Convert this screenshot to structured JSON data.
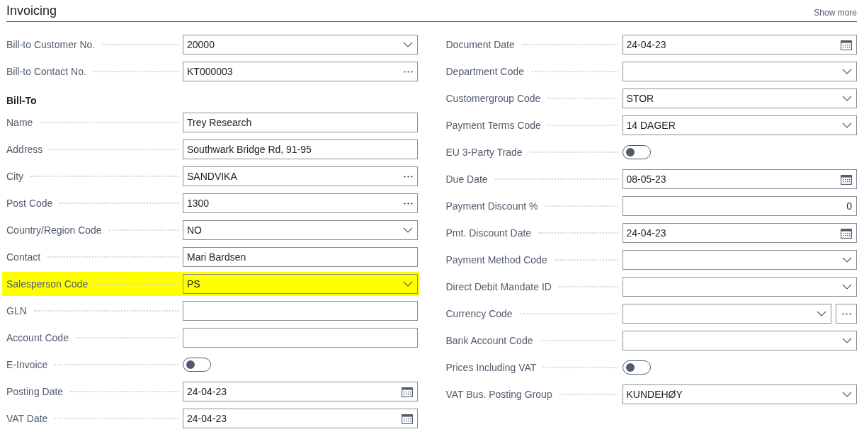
{
  "section": {
    "title": "Invoicing",
    "show_more": "Show more"
  },
  "left_fields": [
    {
      "kind": "dropdown",
      "label": "Bill-to Customer No.",
      "value": "20000",
      "highlighted": false
    },
    {
      "kind": "lookup",
      "label": "Bill-to Contact No.",
      "value": "KT000003",
      "highlighted": false
    },
    {
      "kind": "heading",
      "label": "Bill-To",
      "highlighted": false
    },
    {
      "kind": "text",
      "label": "Name",
      "value": "Trey Research",
      "highlighted": false
    },
    {
      "kind": "text",
      "label": "Address",
      "value": "Southwark Bridge Rd, 91-95",
      "highlighted": false
    },
    {
      "kind": "lookup",
      "label": "City",
      "value": "SANDVIKA",
      "highlighted": false
    },
    {
      "kind": "lookup",
      "label": "Post Code",
      "value": "1300",
      "highlighted": false
    },
    {
      "kind": "dropdown",
      "label": "Country/Region Code",
      "value": "NO",
      "highlighted": false
    },
    {
      "kind": "text",
      "label": "Contact",
      "value": "Mari Bardsen",
      "highlighted": false
    },
    {
      "kind": "dropdown",
      "label": "Salesperson Code",
      "value": "PS",
      "highlighted": true
    },
    {
      "kind": "text",
      "label": "GLN",
      "highlighted": false
    },
    {
      "kind": "text",
      "label": "Account Code",
      "highlighted": false
    },
    {
      "kind": "toggle",
      "label": "E-Invoice",
      "on": false,
      "highlighted": false
    },
    {
      "kind": "date",
      "label": "Posting Date",
      "value": "24-04-23",
      "highlighted": false
    },
    {
      "kind": "date",
      "label": "VAT Date",
      "value": "24-04-23",
      "highlighted": false
    }
  ],
  "right_fields": [
    {
      "kind": "date",
      "label": "Document Date",
      "value": "24-04-23",
      "highlighted": false
    },
    {
      "kind": "dropdown",
      "label": "Department Code",
      "highlighted": false
    },
    {
      "kind": "dropdown",
      "label": "Customergroup Code",
      "value": "STOR",
      "highlighted": false
    },
    {
      "kind": "dropdown",
      "label": "Payment Terms Code",
      "value": "14 DAGER",
      "highlighted": false
    },
    {
      "kind": "toggle",
      "label": "EU 3-Party Trade",
      "on": false,
      "highlighted": false
    },
    {
      "kind": "date",
      "label": "Due Date",
      "value": "08-05-23",
      "highlighted": false
    },
    {
      "kind": "number",
      "label": "Payment Discount %",
      "value": "0",
      "highlighted": false
    },
    {
      "kind": "date",
      "label": "Pmt. Discount Date",
      "value": "24-04-23",
      "highlighted": false
    },
    {
      "kind": "dropdown",
      "label": "Payment Method Code",
      "highlighted": false
    },
    {
      "kind": "dropdown",
      "label": "Direct Debit Mandate ID",
      "highlighted": false
    },
    {
      "kind": "dropdown_lookup",
      "label": "Currency Code",
      "highlighted": false
    },
    {
      "kind": "dropdown",
      "label": "Bank Account Code",
      "highlighted": false
    },
    {
      "kind": "toggle",
      "label": "Prices Including VAT",
      "on": false,
      "highlighted": false
    },
    {
      "kind": "dropdown",
      "label": "VAT Bus. Posting Group",
      "value": "KUNDEHØY",
      "highlighted": false
    }
  ]
}
